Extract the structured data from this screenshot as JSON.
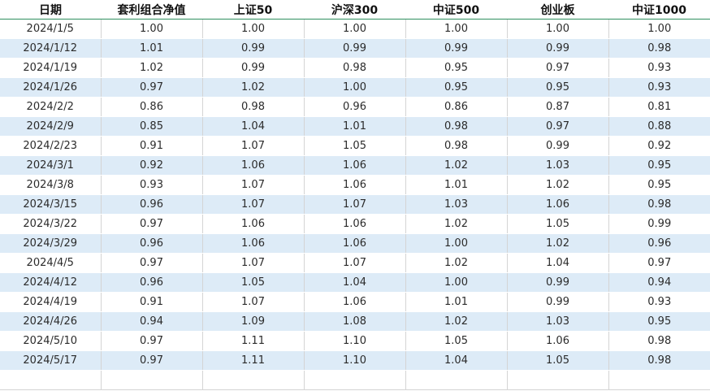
{
  "headers": [
    "日期",
    "套利组合净值",
    "上证50",
    "沪深300",
    "中证500",
    "创业板",
    "中证1000"
  ],
  "rows": [
    [
      "2024/1/5",
      "1.00",
      "1.00",
      "1.00",
      "1.00",
      "1.00",
      "1.00"
    ],
    [
      "2024/1/12",
      "1.01",
      "0.99",
      "0.99",
      "0.99",
      "0.99",
      "0.98"
    ],
    [
      "2024/1/19",
      "1.02",
      "0.99",
      "0.98",
      "0.95",
      "0.97",
      "0.93"
    ],
    [
      "2024/1/26",
      "0.97",
      "1.02",
      "1.00",
      "0.95",
      "0.95",
      "0.93"
    ],
    [
      "2024/2/2",
      "0.86",
      "0.98",
      "0.96",
      "0.86",
      "0.87",
      "0.81"
    ],
    [
      "2024/2/9",
      "0.85",
      "1.04",
      "1.01",
      "0.98",
      "0.97",
      "0.88"
    ],
    [
      "2024/2/23",
      "0.91",
      "1.07",
      "1.05",
      "0.98",
      "0.99",
      "0.92"
    ],
    [
      "2024/3/1",
      "0.92",
      "1.06",
      "1.06",
      "1.02",
      "1.03",
      "0.95"
    ],
    [
      "2024/3/8",
      "0.93",
      "1.07",
      "1.06",
      "1.01",
      "1.02",
      "0.95"
    ],
    [
      "2024/3/15",
      "0.96",
      "1.07",
      "1.07",
      "1.03",
      "1.06",
      "0.98"
    ],
    [
      "2024/3/22",
      "0.97",
      "1.06",
      "1.06",
      "1.02",
      "1.05",
      "0.99"
    ],
    [
      "2024/3/29",
      "0.96",
      "1.06",
      "1.06",
      "1.00",
      "1.02",
      "0.96"
    ],
    [
      "2024/4/5",
      "0.97",
      "1.07",
      "1.07",
      "1.02",
      "1.04",
      "0.97"
    ],
    [
      "2024/4/12",
      "0.96",
      "1.05",
      "1.04",
      "1.00",
      "0.99",
      "0.94"
    ],
    [
      "2024/4/19",
      "0.91",
      "1.07",
      "1.06",
      "1.01",
      "0.99",
      "0.93"
    ],
    [
      "2024/4/26",
      "0.94",
      "1.09",
      "1.08",
      "1.02",
      "1.03",
      "0.95"
    ],
    [
      "2024/5/10",
      "0.97",
      "1.11",
      "1.10",
      "1.05",
      "1.06",
      "0.98"
    ],
    [
      "2024/5/17",
      "0.97",
      "1.11",
      "1.10",
      "1.04",
      "1.05",
      "0.98"
    ]
  ],
  "colors": {
    "band": "#ddebf7",
    "header_rule": "#2f8f5f",
    "grid": "#d4d4d4"
  }
}
